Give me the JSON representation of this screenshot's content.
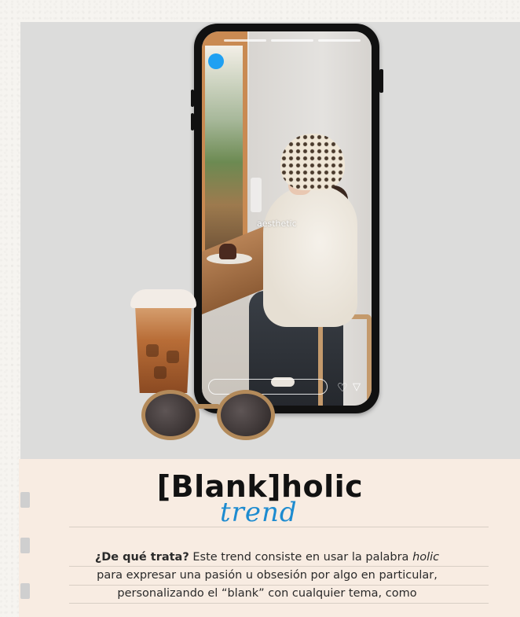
{
  "phone_story": {
    "username": "aesthetic",
    "progress_segments": 3
  },
  "article": {
    "title": "[Blank]holic",
    "subtitle": "trend",
    "question": "¿De qué trata?",
    "line1_rest_a": " Este trend consiste en usar la palabra ",
    "line1_italic": "holic",
    "line2": "para expresar una pasión u obsesión por algo en particular,",
    "line3": "personalizando el “blank” con cualquier tema, como"
  },
  "colors": {
    "accent_blue": "#1d8bd0",
    "story_dot": "#1fa0f2",
    "card_bg": "#f8ece2",
    "panel_bg": "#dcdcdb"
  },
  "icons": [
    "heart-icon",
    "send-icon"
  ]
}
